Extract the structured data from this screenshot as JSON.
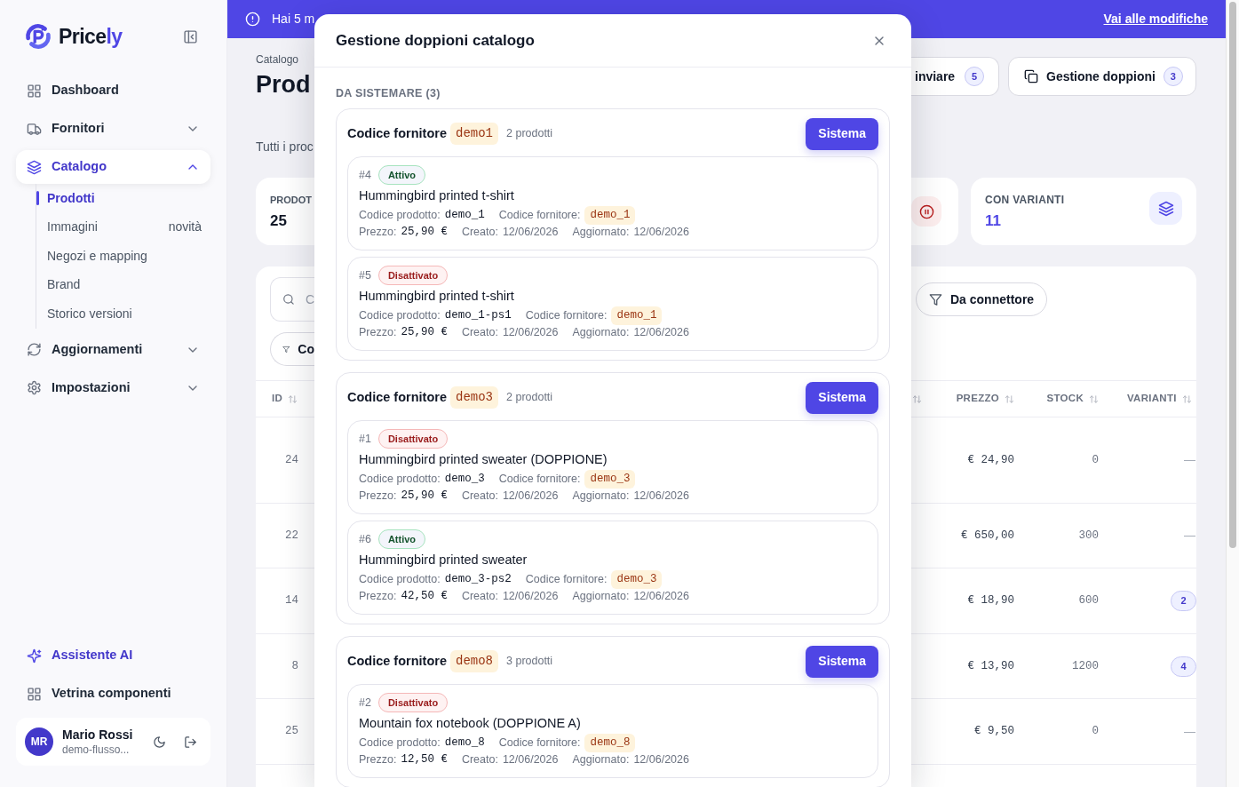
{
  "sidebar": {
    "logo": {
      "text": "Price",
      "accent": "ly"
    },
    "nav": [
      {
        "label": "Dashboard",
        "selected": false
      },
      {
        "label": "Fornitori",
        "selected": false,
        "expanded": false
      },
      {
        "label": "Catalogo",
        "selected": true,
        "expanded": true,
        "children": [
          {
            "label": "Prodotti",
            "selected": true
          },
          {
            "label": "Immagini",
            "badge": "novità",
            "selected": false
          },
          {
            "label": "Negozi e mapping",
            "selected": false
          },
          {
            "label": "Brand",
            "selected": false
          },
          {
            "label": "Storico versioni",
            "selected": false
          }
        ]
      },
      {
        "label": "Aggiornamenti",
        "selected": false,
        "expanded": false
      },
      {
        "label": "Impostazioni",
        "selected": false,
        "expanded": false
      }
    ],
    "footer_nav": [
      {
        "label": "Assistente AI",
        "kind": "accent"
      },
      {
        "label": "Vetrina componenti",
        "kind": "plain"
      }
    ],
    "user": {
      "initials": "MR",
      "name": "Mario Rossi",
      "email": "demo-flusso..."
    }
  },
  "banner": {
    "text": "Hai 5 m",
    "link": "Vai alle modifiche"
  },
  "page": {
    "breadcrumb": "Catalogo",
    "title": "Prod",
    "subtitle": "Tutti i proc",
    "actions": [
      {
        "label": "inviare",
        "count": "5"
      },
      {
        "label": "Gestione doppioni",
        "count": "3"
      }
    ],
    "stats": [
      {
        "label": "PRODOT",
        "value": "25"
      },
      {
        "label": "CON VARIANTI",
        "value": "11"
      }
    ],
    "search": {
      "placeholder": "C"
    },
    "filters": [
      {
        "label": "Co"
      },
      {
        "label": "Da connettore"
      }
    ],
    "table": {
      "columns": [
        {
          "label": "ID"
        },
        {
          "label": "PREZZO"
        },
        {
          "label": "STOCK"
        },
        {
          "label": "VARIANTI"
        }
      ],
      "rows": [
        {
          "id": "24",
          "price": "€ 24,90",
          "stock": "0",
          "variants": {
            "kind": "none",
            "text": "—"
          }
        },
        {
          "id": "22",
          "price": "€ 650,00",
          "stock": "300",
          "variants": {
            "kind": "none",
            "text": "—"
          }
        },
        {
          "id": "14",
          "price": "€ 18,90",
          "stock": "600",
          "variants": {
            "kind": "badge",
            "text": "2"
          }
        },
        {
          "id": "8",
          "price": "€ 13,90",
          "stock": "1200",
          "variants": {
            "kind": "badge",
            "text": "4"
          }
        },
        {
          "id": "25",
          "price": "€ 9,50",
          "stock": "0",
          "variants": {
            "kind": "none",
            "text": "—"
          }
        }
      ]
    }
  },
  "modal": {
    "title": "Gestione doppioni catalogo",
    "section": "DA SISTEMARE (3)",
    "groups": [
      {
        "label": "Codice fornitore",
        "code": "demo1",
        "count": "2 prodotti",
        "action": "Sistema",
        "items": [
          {
            "id": "#4",
            "status": {
              "label": "Attivo",
              "kind": "active"
            },
            "name": "Hummingbird printed t-shirt",
            "fields": [
              {
                "label": "Codice prodotto:",
                "value": "demo_1",
                "kind": "mono"
              },
              {
                "label": "Codice fornitore:",
                "value": "demo_1",
                "kind": "code"
              }
            ],
            "meta": [
              {
                "label": "Prezzo:",
                "value": "25,90 €",
                "kind": "mono"
              },
              {
                "label": "Creato:",
                "value": "12/06/2026",
                "kind": "plain"
              },
              {
                "label": "Aggiornato:",
                "value": "12/06/2026",
                "kind": "plain"
              }
            ]
          },
          {
            "id": "#5",
            "status": {
              "label": "Disattivato",
              "kind": "inactive"
            },
            "name": "Hummingbird printed t-shirt",
            "fields": [
              {
                "label": "Codice prodotto:",
                "value": "demo_1-ps1",
                "kind": "mono"
              },
              {
                "label": "Codice fornitore:",
                "value": "demo_1",
                "kind": "code"
              }
            ],
            "meta": [
              {
                "label": "Prezzo:",
                "value": "25,90 €",
                "kind": "mono"
              },
              {
                "label": "Creato:",
                "value": "12/06/2026",
                "kind": "plain"
              },
              {
                "label": "Aggiornato:",
                "value": "12/06/2026",
                "kind": "plain"
              }
            ]
          }
        ]
      },
      {
        "label": "Codice fornitore",
        "code": "demo3",
        "count": "2 prodotti",
        "action": "Sistema",
        "items": [
          {
            "id": "#1",
            "status": {
              "label": "Disattivato",
              "kind": "inactive"
            },
            "name": "Hummingbird printed sweater (DOPPIONE)",
            "fields": [
              {
                "label": "Codice prodotto:",
                "value": "demo_3",
                "kind": "mono"
              },
              {
                "label": "Codice fornitore:",
                "value": "demo_3",
                "kind": "code"
              }
            ],
            "meta": [
              {
                "label": "Prezzo:",
                "value": "25,90 €",
                "kind": "mono"
              },
              {
                "label": "Creato:",
                "value": "12/06/2026",
                "kind": "plain"
              },
              {
                "label": "Aggiornato:",
                "value": "12/06/2026",
                "kind": "plain"
              }
            ]
          },
          {
            "id": "#6",
            "status": {
              "label": "Attivo",
              "kind": "active"
            },
            "name": "Hummingbird printed sweater",
            "fields": [
              {
                "label": "Codice prodotto:",
                "value": "demo_3-ps2",
                "kind": "mono"
              },
              {
                "label": "Codice fornitore:",
                "value": "demo_3",
                "kind": "code"
              }
            ],
            "meta": [
              {
                "label": "Prezzo:",
                "value": "42,50 €",
                "kind": "mono"
              },
              {
                "label": "Creato:",
                "value": "12/06/2026",
                "kind": "plain"
              },
              {
                "label": "Aggiornato:",
                "value": "12/06/2026",
                "kind": "plain"
              }
            ]
          }
        ]
      },
      {
        "label": "Codice fornitore",
        "code": "demo8",
        "count": "3 prodotti",
        "action": "Sistema",
        "items": [
          {
            "id": "#2",
            "status": {
              "label": "Disattivato",
              "kind": "inactive"
            },
            "name": "Mountain fox notebook (DOPPIONE A)",
            "fields": [
              {
                "label": "Codice prodotto:",
                "value": "demo_8",
                "kind": "mono"
              },
              {
                "label": "Codice fornitore:",
                "value": "demo_8",
                "kind": "code"
              }
            ],
            "meta": [
              {
                "label": "Prezzo:",
                "value": "12,50 €",
                "kind": "mono"
              },
              {
                "label": "Creato:",
                "value": "12/06/2026",
                "kind": "plain"
              },
              {
                "label": "Aggiornato:",
                "value": "12/06/2026",
                "kind": "plain"
              }
            ]
          }
        ]
      }
    ]
  }
}
